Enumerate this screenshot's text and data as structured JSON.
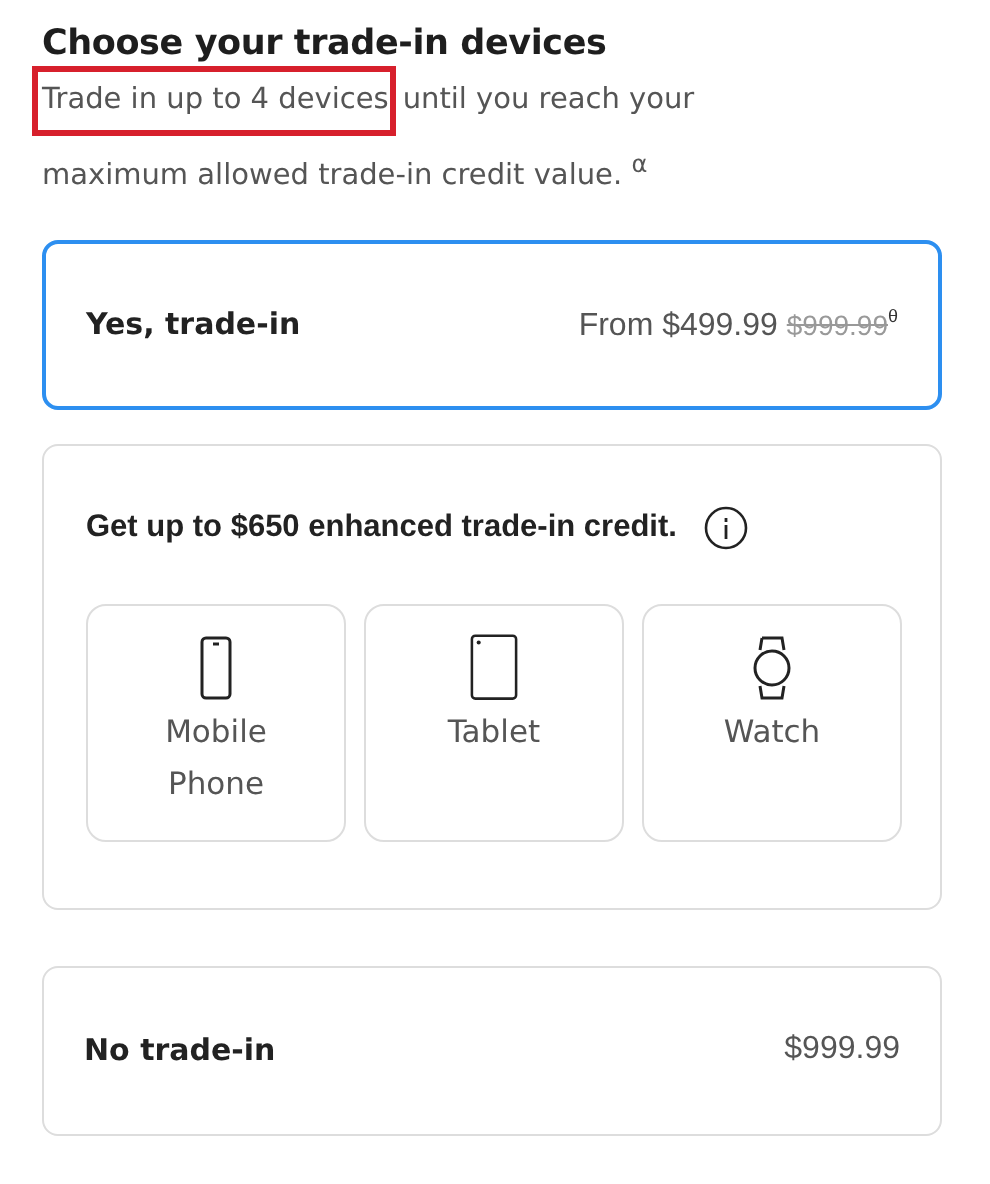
{
  "title": "Choose your trade-in devices",
  "description": {
    "highlighted": "Trade in up to 4 devices",
    "rest": "until you reach your",
    "continuation": "maximum allowed trade-in credit value. $^{α}$"
  },
  "options": [
    {
      "label": "Yes, trade-in",
      "price": "From $499.99",
      "original_price": "$999.99",
      "footnote": "θ",
      "selected": true
    }
  ],
  "enhanced": {
    "text": "Get up to $650 enhanced trade-in credit.",
    "devices": [
      {
        "kind": "phone",
        "label": "Mobile Phone",
        "selected": false
      },
      {
        "kind": "tablet",
        "label": "Tablet",
        "selected": false
      },
      {
        "kind": "watch",
        "label": "Watch",
        "selected": false
      }
    ]
  },
  "no_trade": {
    "label": "No trade-in",
    "price": "$999.99",
    "selected": false
  }
}
